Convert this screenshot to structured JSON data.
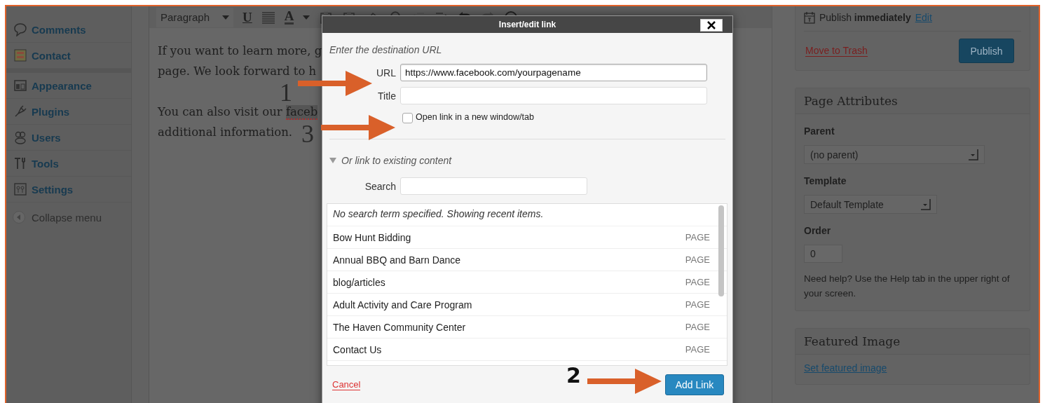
{
  "sidebar": {
    "groups": [
      {
        "items": [
          {
            "label": "Comments"
          },
          {
            "label": "Contact"
          }
        ]
      },
      {
        "items": [
          {
            "label": "Appearance"
          },
          {
            "label": "Plugins"
          },
          {
            "label": "Users"
          },
          {
            "label": "Tools"
          },
          {
            "label": "Settings"
          }
        ]
      }
    ],
    "collapse": "Collapse menu"
  },
  "toolbar": {
    "format": "Paragraph",
    "underline": "U",
    "text_color": "A"
  },
  "editor": {
    "paragraphs": [
      {
        "lines": [
          {
            "text": "If you want to learn more, g"
          },
          {
            "text": "page. We look forward to h"
          }
        ]
      },
      {
        "lines": [
          {
            "text": "You can also visit our ",
            "selection": "faceb"
          },
          {
            "text": "additional information."
          }
        ]
      }
    ]
  },
  "publish": {
    "schedule": "Publish **immediately**",
    "edit_link": "Edit",
    "trash_link": "Move to Trash",
    "button": "Publish"
  },
  "page_attributes": {
    "title": "Page Attributes",
    "parent_label": "Parent",
    "parent_value": "(no parent)",
    "template_label": "Template",
    "template_value": "Default Template",
    "order_label": "Order",
    "order_value": "0",
    "help": "Need help? Use the Help tab in the upper right of your screen."
  },
  "featured_image": {
    "title": "Featured Image",
    "link": "Set featured image"
  },
  "dialog": {
    "title": "Insert/edit link",
    "url_heading": "Enter the destination URL",
    "url_label": "URL",
    "url_value": "https://www.facebook.com/yourpagename",
    "title_label": "Title",
    "new_tab": {
      "label": "Open link in a new window/tab",
      "checked": false
    },
    "existing": {
      "label": "Or link to existing content",
      "expanded": true
    },
    "search_label": "Search",
    "results_note": "No search term specified. Showing recent items.",
    "results": [
      {
        "title": "Bow Hunt Bidding",
        "type": "PAGE",
        "selected": false
      },
      {
        "title": "Annual BBQ and Barn Dance",
        "type": "PAGE",
        "selected": false
      },
      {
        "title": "blog/articles",
        "type": "PAGE",
        "selected": false
      },
      {
        "title": "Adult Activity and Care Program",
        "type": "PAGE",
        "selected": false
      },
      {
        "title": "The Haven Community Center",
        "type": "PAGE",
        "selected": false
      },
      {
        "title": "Contact Us",
        "type": "PAGE",
        "selected": false
      }
    ],
    "cancel": "Cancel",
    "submit": "Add Link"
  },
  "annotations": [
    {
      "number": "1",
      "kind": "url"
    },
    {
      "number": "3",
      "kind": "new-tab"
    },
    {
      "number": "2",
      "kind": "submit"
    }
  ]
}
